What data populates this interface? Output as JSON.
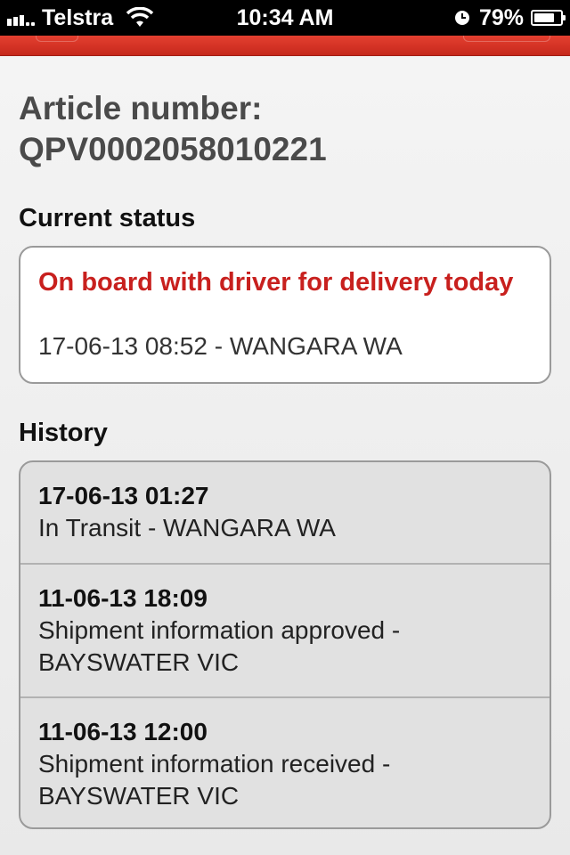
{
  "status_bar": {
    "carrier": "Telstra",
    "time": "10:34 AM",
    "battery": "79%",
    "battery_level": 0.79
  },
  "article": {
    "label": "Article number:",
    "number": "QPV0002058010221"
  },
  "current_status": {
    "section_label": "Current status",
    "status": "On board with driver for delivery today",
    "detail": "17-06-13 08:52 - WANGARA WA"
  },
  "history": {
    "section_label": "History",
    "items": [
      {
        "time": "17-06-13 01:27",
        "line1": "In Transit - WANGARA WA",
        "line2": ""
      },
      {
        "time": "11-06-13 18:09",
        "line1": "Shipment information approved -",
        "line2": "BAYSWATER VIC"
      },
      {
        "time": "11-06-13 12:00",
        "line1": "Shipment information received -",
        "line2": "BAYSWATER VIC"
      }
    ]
  },
  "colors": {
    "accent_red": "#c8201e",
    "header_red": "#d6321f"
  },
  "icons": {
    "signal": "signal-bars-icon",
    "wifi": "wifi-icon",
    "clock": "alarm-clock-icon",
    "battery": "battery-icon"
  }
}
